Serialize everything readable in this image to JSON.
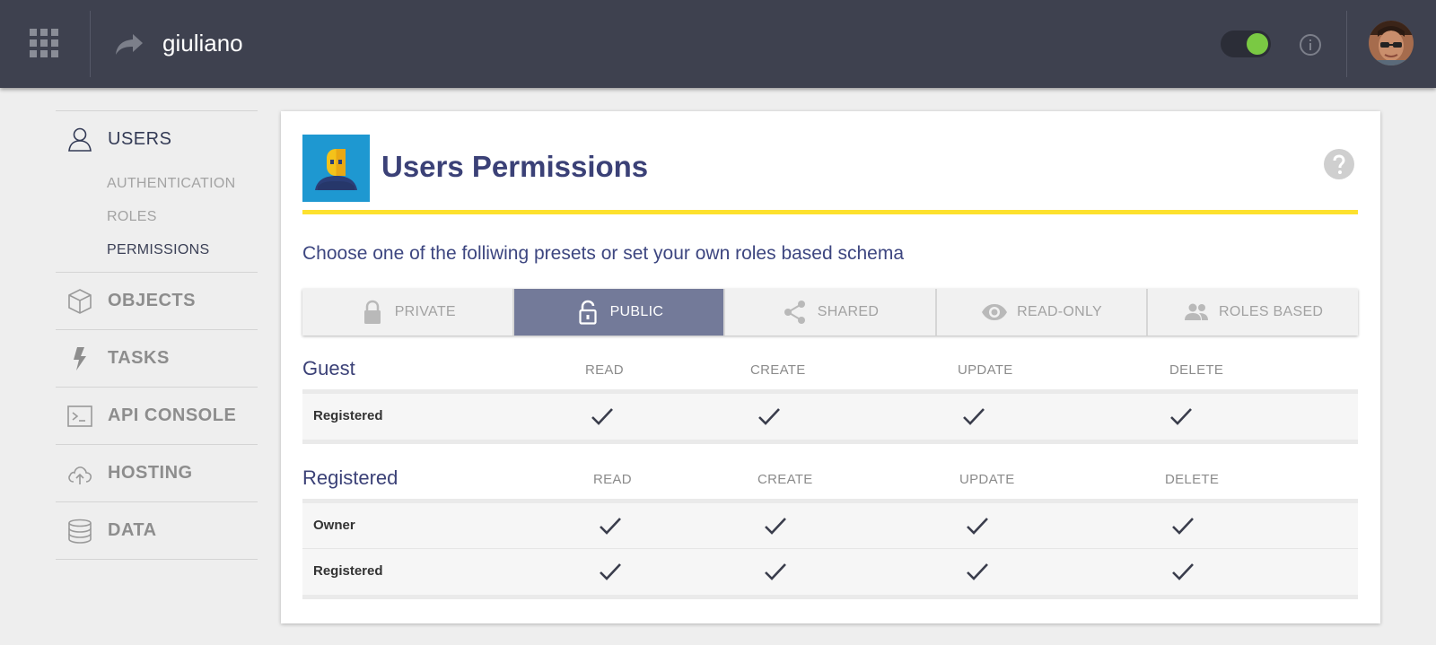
{
  "header": {
    "project_name": "giuliano",
    "toggle_on": true,
    "toggle_color": "#7ac943",
    "bg_color": "#3e414f"
  },
  "sidebar": {
    "sections": [
      {
        "label": "USERS",
        "icon": "user-icon",
        "active": true
      },
      {
        "label": "OBJECTS",
        "icon": "cube-icon",
        "active": false
      },
      {
        "label": "TASKS",
        "icon": "lightning-icon",
        "active": false
      },
      {
        "label": "API CONSOLE",
        "icon": "terminal-icon",
        "active": false
      },
      {
        "label": "HOSTING",
        "icon": "cloud-upload-icon",
        "active": false
      },
      {
        "label": "DATA",
        "icon": "database-icon",
        "active": false
      }
    ],
    "users_subitems": [
      {
        "label": "AUTHENTICATION",
        "active": false
      },
      {
        "label": "ROLES",
        "active": false
      },
      {
        "label": "PERMISSIONS",
        "active": true
      }
    ]
  },
  "card": {
    "title": "Users Permissions",
    "subtitle": "Choose one of the folliwing presets or set your own roles based schema",
    "accent_color": "#fde12e",
    "presets": [
      {
        "label": "PRIVATE",
        "icon": "lock-icon",
        "active": false
      },
      {
        "label": "PUBLIC",
        "icon": "unlock-icon",
        "active": true
      },
      {
        "label": "SHARED",
        "icon": "share-icon",
        "active": false
      },
      {
        "label": "READ-ONLY",
        "icon": "eye-icon",
        "active": false
      },
      {
        "label": "ROLES BASED",
        "icon": "people-icon",
        "active": false
      }
    ],
    "groups": [
      {
        "name": "Guest",
        "columns": [
          "READ",
          "CREATE",
          "UPDATE",
          "DELETE"
        ],
        "rows": [
          {
            "label": "Registered",
            "read": true,
            "create": true,
            "update": true,
            "delete": true
          }
        ]
      },
      {
        "name": "Registered",
        "columns": [
          "READ",
          "CREATE",
          "UPDATE",
          "DELETE"
        ],
        "rows": [
          {
            "label": "Owner",
            "read": true,
            "create": true,
            "update": true,
            "delete": true
          },
          {
            "label": "Registered",
            "read": true,
            "create": true,
            "update": true,
            "delete": true
          }
        ]
      }
    ]
  }
}
